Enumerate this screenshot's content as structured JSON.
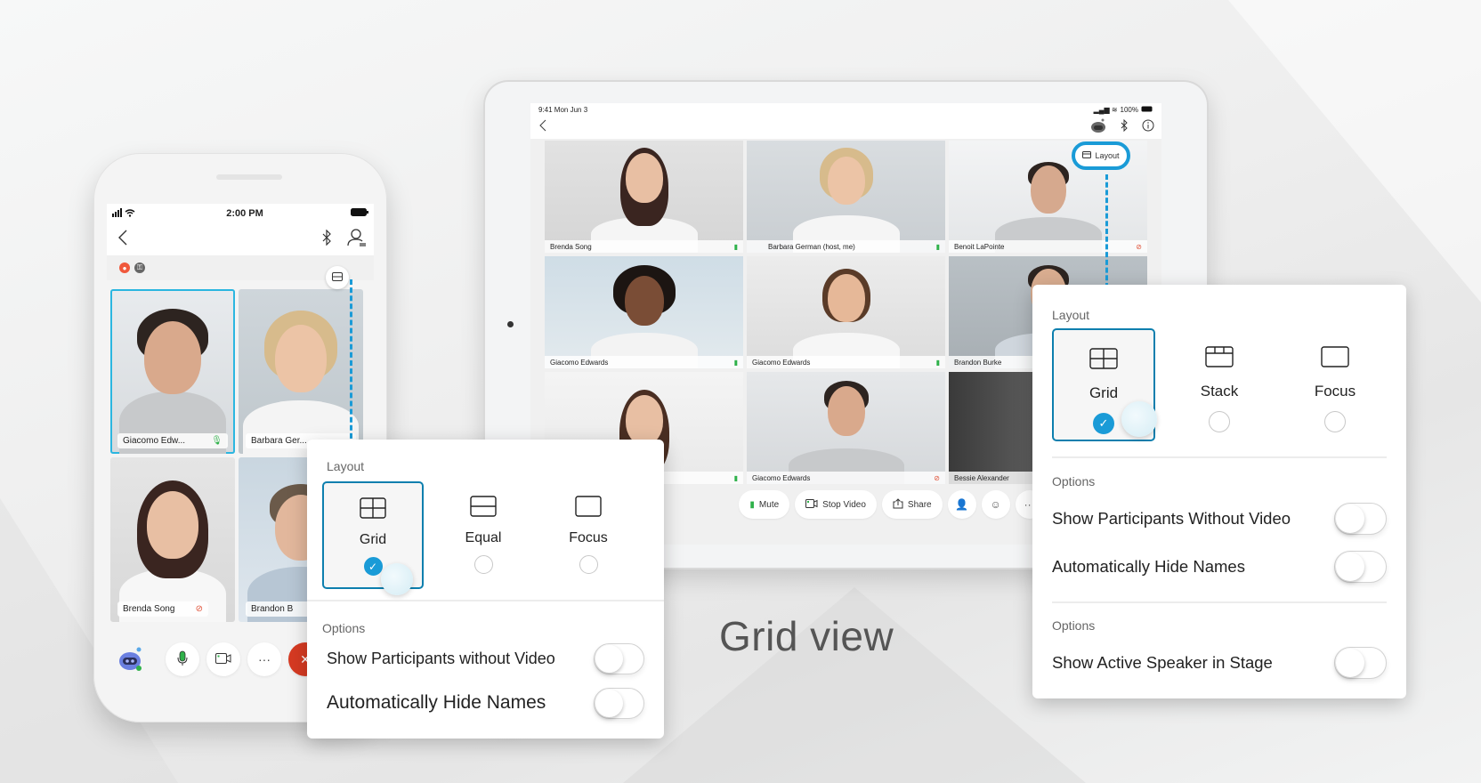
{
  "caption": "Grid view",
  "colors": {
    "accent": "#1a9bd7",
    "selected_border": "#0d7fae",
    "end_call": "#d63a22",
    "mic_on": "#2fb14a",
    "mic_muted": "#e0553c"
  },
  "phone": {
    "status": {
      "time": "2:00 PM"
    },
    "nav": {
      "back_icon": "chevron-left-icon",
      "bluetooth_icon": "bluetooth-icon",
      "participants_icon": "participants-icon"
    },
    "meta_icons": [
      "recording-icon",
      "lock-icon"
    ],
    "layout_button_icon": "layout-icon",
    "tiles": [
      {
        "name": "Giacomo Edw...",
        "mic": "on",
        "active": true
      },
      {
        "name": "Barbara Ger...",
        "mic": "none",
        "active": false
      },
      {
        "name": "Brenda Song",
        "mic": "muted",
        "active": false
      },
      {
        "name": "Brandon B",
        "mic": "none",
        "active": false
      }
    ],
    "controls": [
      "assistant-icon",
      "microphone-icon",
      "video-camera-icon",
      "more-icon",
      "end-call-icon"
    ]
  },
  "phone_popover": {
    "layout_label": "Layout",
    "options": [
      {
        "label": "Grid",
        "icon": "grid-layout-icon",
        "selected": true
      },
      {
        "label": "Equal",
        "icon": "equal-layout-icon",
        "selected": false
      },
      {
        "label": "Focus",
        "icon": "focus-layout-icon",
        "selected": false
      }
    ],
    "options_label": "Options",
    "toggles": [
      {
        "label": "Show Participants without Video",
        "on": false
      },
      {
        "label": "Automatically Hide Names",
        "on": false
      }
    ]
  },
  "tablet": {
    "status": {
      "time": "9:41  Mon Jun 3",
      "battery": "100%"
    },
    "layout_button": "Layout",
    "tiles": [
      {
        "name": "Brenda Song",
        "mic": "on"
      },
      {
        "name": "Barbara German (host, me)",
        "mic": "on"
      },
      {
        "name": "Benoit LaPointe",
        "mic": "muted"
      },
      {
        "name": "Giacomo Edwards",
        "mic": "on"
      },
      {
        "name": "Giacomo Edwards",
        "mic": "on"
      },
      {
        "name": "Brandon Burke",
        "mic": "none"
      },
      {
        "name": "",
        "mic": "on"
      },
      {
        "name": "Giacomo Edwards",
        "mic": "muted"
      },
      {
        "name": "Bessie Alexander",
        "mic": "none"
      }
    ],
    "controls": {
      "mute": "Mute",
      "stop_video": "Stop Video",
      "share": "Share"
    }
  },
  "tablet_popover": {
    "layout_label": "Layout",
    "options": [
      {
        "label": "Grid",
        "icon": "grid-layout-icon",
        "selected": true
      },
      {
        "label": "Stack",
        "icon": "stack-layout-icon",
        "selected": false
      },
      {
        "label": "Focus",
        "icon": "focus-layout-icon",
        "selected": false
      }
    ],
    "options_label_1": "Options",
    "toggles_1": [
      {
        "label": "Show Participants Without Video",
        "on": false
      },
      {
        "label": "Automatically Hide Names",
        "on": false
      }
    ],
    "options_label_2": "Options",
    "toggles_2": [
      {
        "label": "Show Active Speaker in Stage",
        "on": false
      }
    ]
  }
}
